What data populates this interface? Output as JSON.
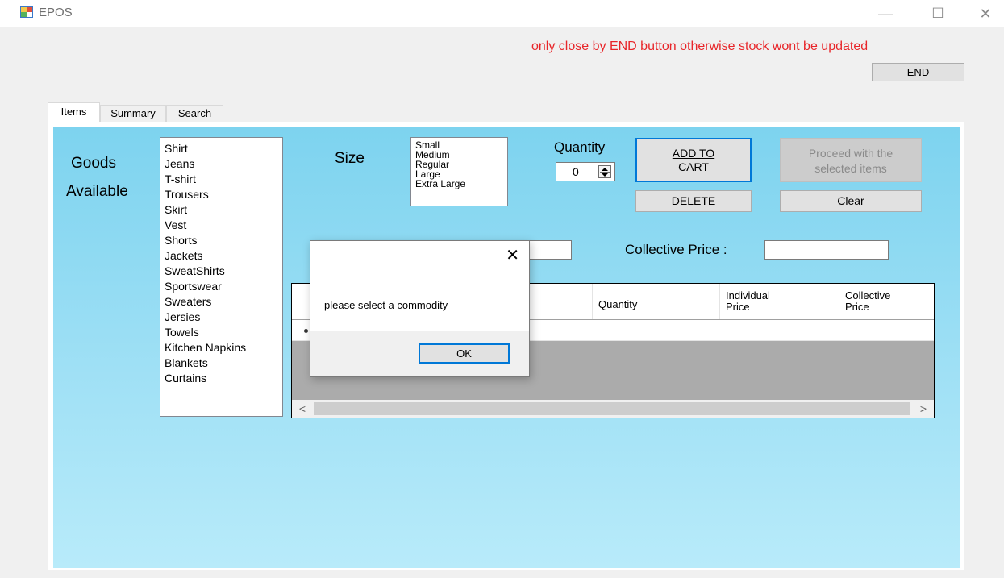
{
  "window": {
    "title": "EPOS",
    "minimize": "—",
    "maximize": "☐",
    "close": "✕"
  },
  "warning": "only close by END button otherwise stock wont be updated",
  "end_button": "END",
  "tabs": [
    {
      "label": "Items",
      "active": true
    },
    {
      "label": "Summary",
      "active": false
    },
    {
      "label": "Search",
      "active": false
    }
  ],
  "goods": {
    "label_line1": "Goods",
    "label_line2": "Available",
    "items": [
      "Shirt",
      "Jeans",
      "T-shirt",
      "Trousers",
      "Skirt",
      "Vest",
      "Shorts",
      "Jackets",
      "SweatShirts",
      "Sportswear",
      "Sweaters",
      "Jersies",
      "Towels",
      "Kitchen Napkins",
      "Blankets",
      "Curtains"
    ]
  },
  "size": {
    "label": "Size",
    "items": [
      "Small",
      "Medium",
      "Regular",
      "Large",
      "Extra Large"
    ]
  },
  "quantity": {
    "label": "Quantity",
    "value": "0"
  },
  "buttons": {
    "add_to_cart_line1": "ADD TO",
    "add_to_cart_line2": "CART",
    "delete": "DELETE",
    "proceed_line1": "Proceed with the",
    "proceed_line2": "selected items",
    "clear": "Clear"
  },
  "collective_price_label": "Collective Price :",
  "grid": {
    "columns": [
      {
        "line1": "Quantity",
        "line2": ""
      },
      {
        "line1": "Individual",
        "line2": "Price"
      },
      {
        "line1": "Collective",
        "line2": "Price"
      }
    ]
  },
  "dialog": {
    "message": "please select a commodity",
    "ok": "OK",
    "close": "✕"
  },
  "colors": {
    "warning": "#e8262a",
    "panel_top": "#7dd3ef",
    "panel_bottom": "#b8ebfa",
    "focus_blue": "#0078d7"
  }
}
